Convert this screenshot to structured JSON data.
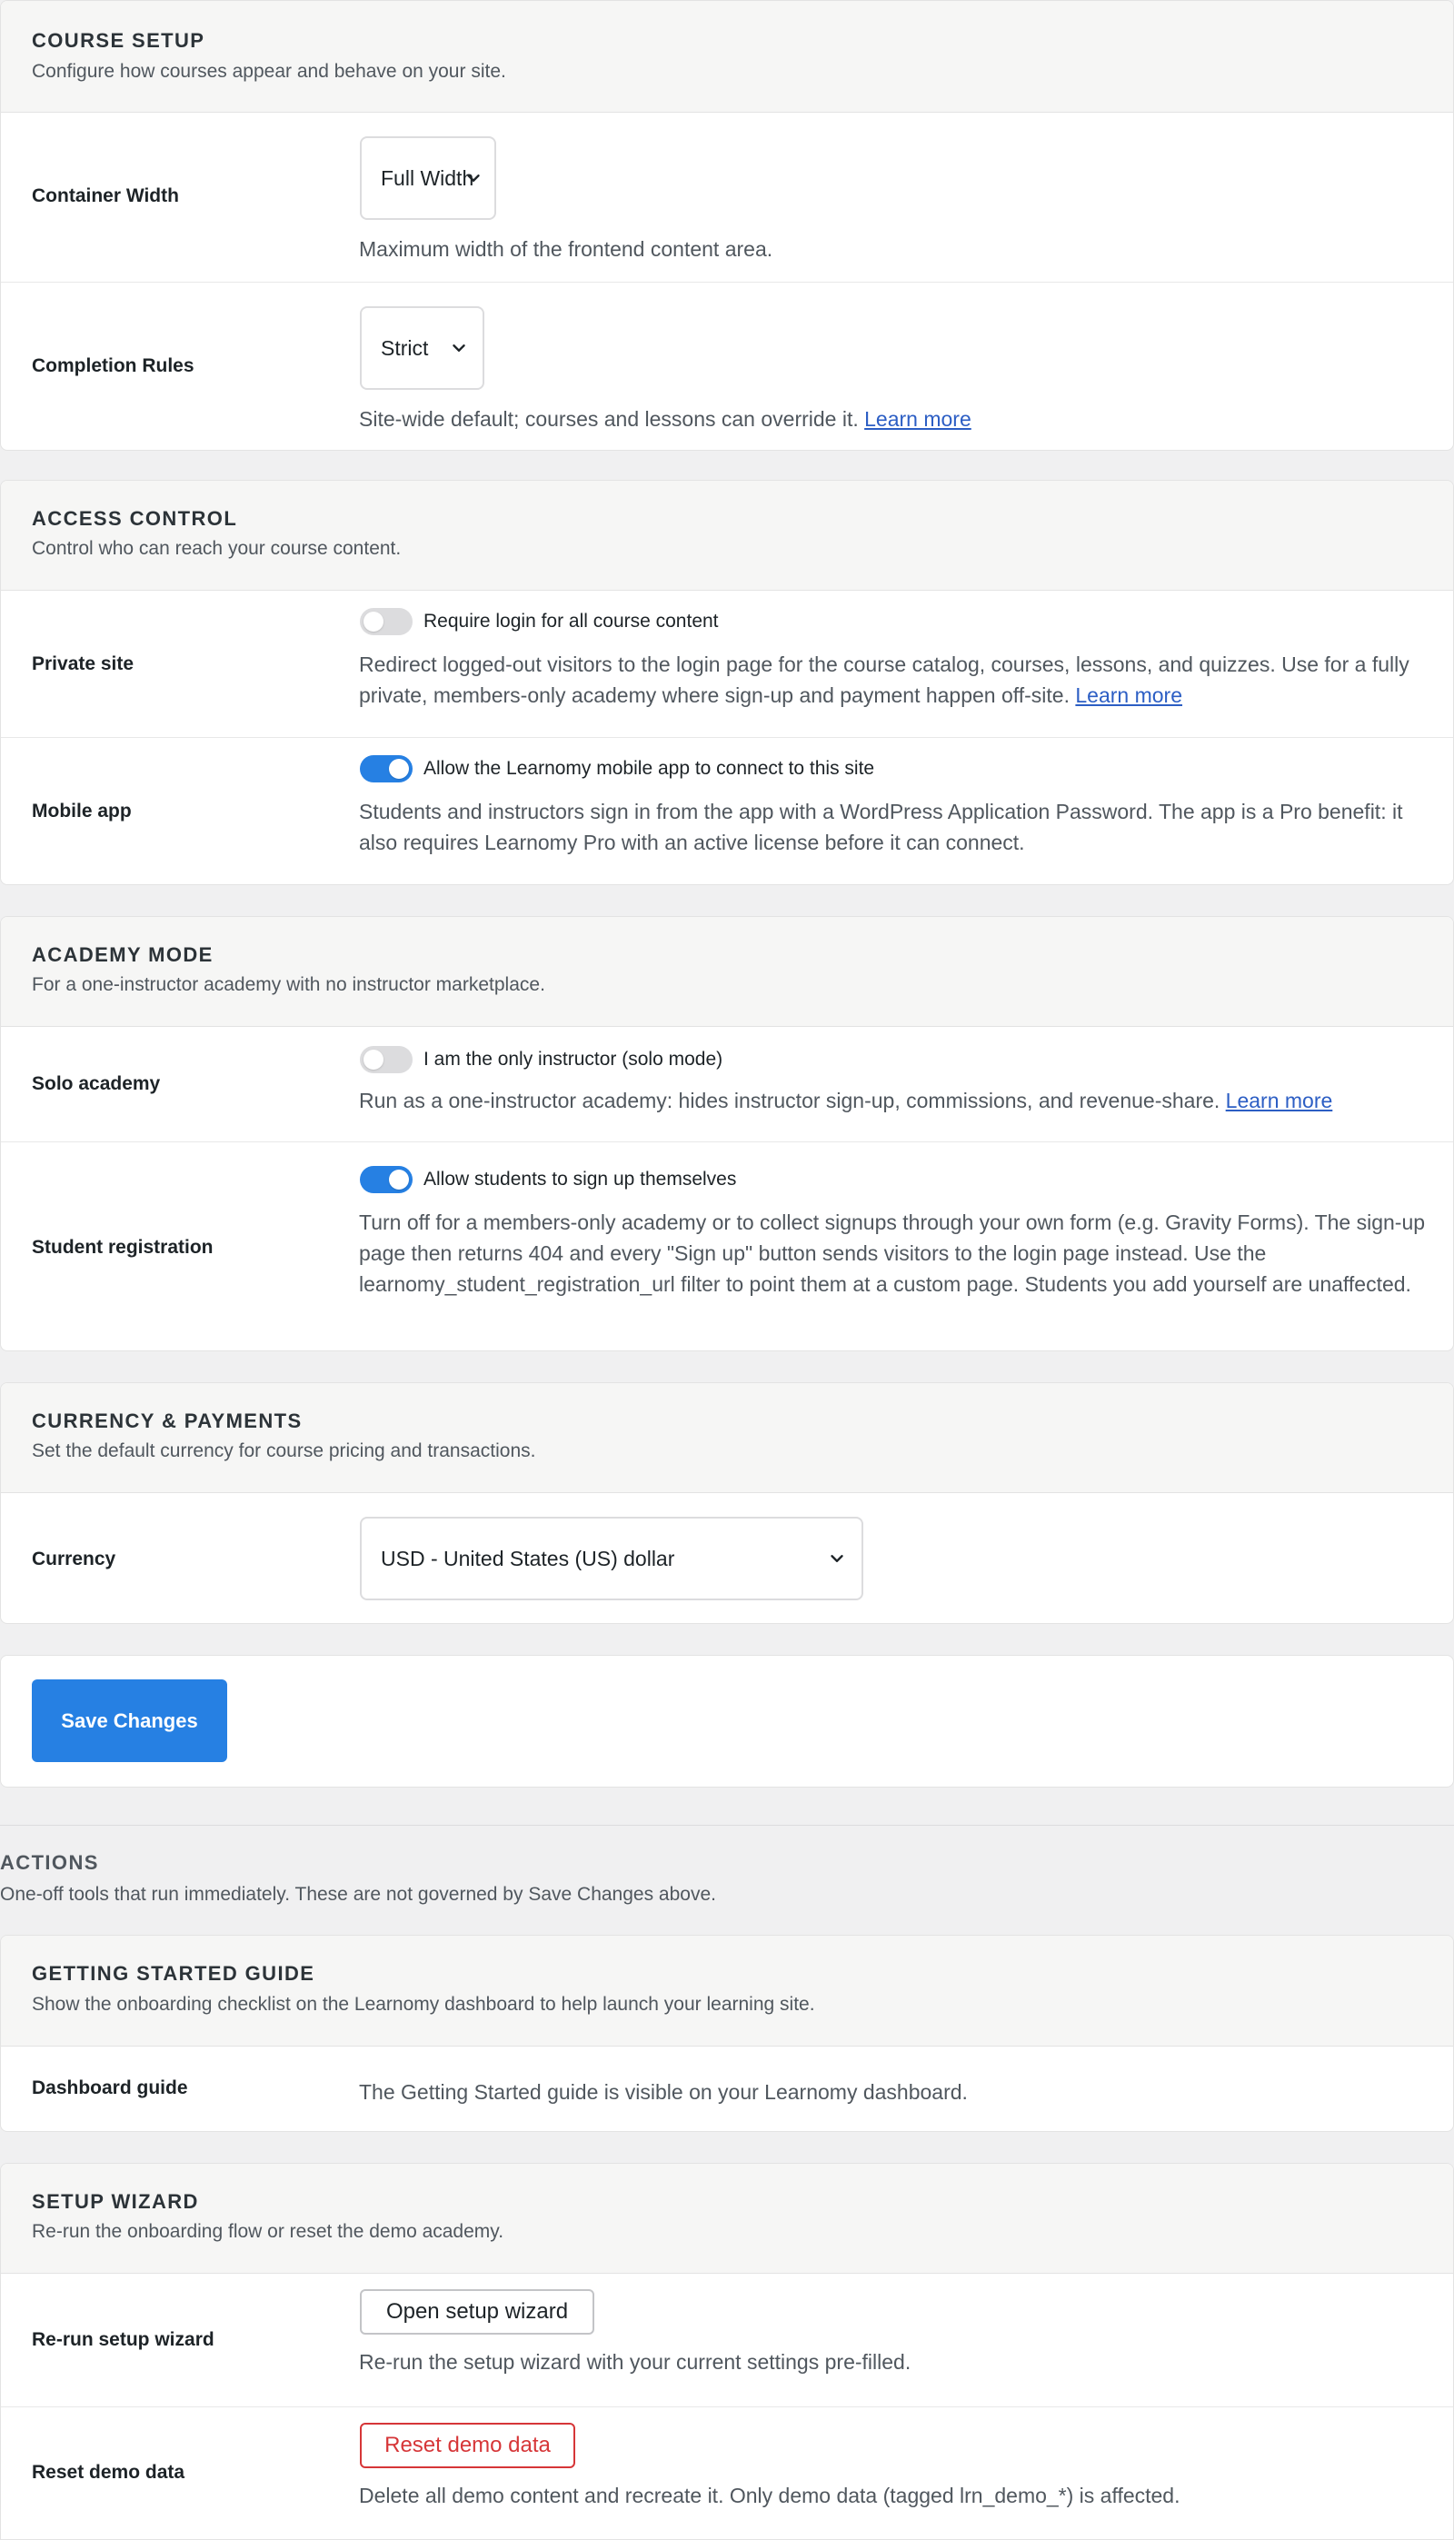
{
  "course_setup": {
    "title": "COURSE SETUP",
    "description": "Configure how courses appear and behave on your site.",
    "container_width": {
      "label": "Container Width",
      "value": "Full Width",
      "help": "Maximum width of the frontend content area."
    },
    "completion_rules": {
      "label": "Completion Rules",
      "value": "Strict",
      "help": "Site-wide default; courses and lessons can override it.",
      "link": "Learn more"
    }
  },
  "access_control": {
    "title": "ACCESS CONTROL",
    "description": "Control who can reach your course content.",
    "private_site": {
      "label": "Private site",
      "toggle_label": "Require login for all course content",
      "enabled": false,
      "help": "Redirect logged-out visitors to the login page for the course catalog, courses, lessons, and quizzes. Use for a fully private, members-only academy where sign-up and payment happen off-site.",
      "link": "Learn more"
    },
    "mobile_app": {
      "label": "Mobile app",
      "toggle_label": "Allow the Learnomy mobile app to connect to this site",
      "enabled": true,
      "help": "Students and instructors sign in from the app with a WordPress Application Password. The app is a Pro benefit: it also requires Learnomy Pro with an active license before it can connect."
    }
  },
  "academy_mode": {
    "title": "ACADEMY MODE",
    "description": "For a one-instructor academy with no instructor marketplace.",
    "solo_academy": {
      "label": "Solo academy",
      "toggle_label": "I am the only instructor (solo mode)",
      "enabled": false,
      "help": "Run as a one-instructor academy: hides instructor sign-up, commissions, and revenue-share.",
      "link": "Learn more"
    },
    "student_registration": {
      "label": "Student registration",
      "toggle_label": "Allow students to sign up themselves",
      "enabled": true,
      "help": "Turn off for a members-only academy or to collect signups through your own form (e.g. Gravity Forms). The sign-up page then returns 404 and every \"Sign up\" button sends visitors to the login page instead. Use the learnomy_student_registration_url filter to point them at a custom page. Students you add yourself are unaffected."
    }
  },
  "currency_payments": {
    "title": "CURRENCY & PAYMENTS",
    "description": "Set the default currency for course pricing and transactions.",
    "currency": {
      "label": "Currency",
      "value": "USD - United States (US) dollar"
    }
  },
  "save": {
    "label": "Save Changes"
  },
  "actions": {
    "title": "ACTIONS",
    "description": "One-off tools that run immediately. These are not governed by Save Changes above."
  },
  "getting_started": {
    "title": "GETTING STARTED GUIDE",
    "description": "Show the onboarding checklist on the Learnomy dashboard to help launch your learning site.",
    "dashboard_guide": {
      "label": "Dashboard guide",
      "status": "The Getting Started guide is visible on your Learnomy dashboard."
    }
  },
  "setup_wizard": {
    "title": "SETUP WIZARD",
    "description": "Re-run the onboarding flow or reset the demo academy.",
    "rerun": {
      "label": "Re-run setup wizard",
      "button": "Open setup wizard",
      "help": "Re-run the setup wizard with your current settings pre-filled."
    },
    "reset": {
      "label": "Reset demo data",
      "button": "Reset demo data",
      "help": "Delete all demo content and recreate it. Only demo data (tagged lrn_demo_*) is affected."
    }
  },
  "colors": {
    "accent": "#2680e3",
    "link": "#2c5ec4",
    "danger": "#d63638",
    "page_bg": "#f0f0f1",
    "card_header_bg": "#f6f6f5"
  }
}
